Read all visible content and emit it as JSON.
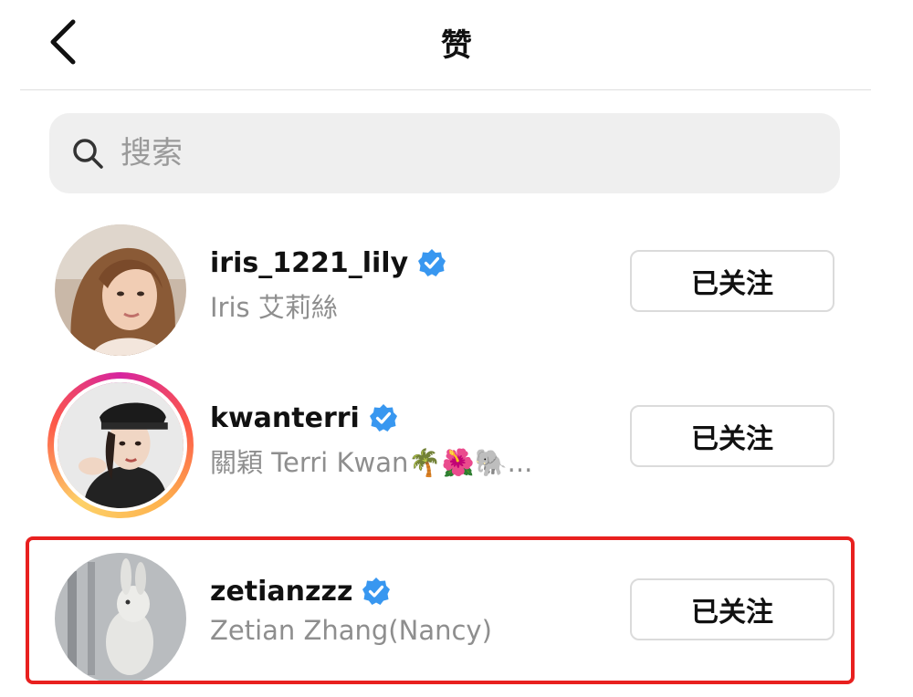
{
  "header": {
    "title": "赞"
  },
  "search": {
    "placeholder": "搜索"
  },
  "users": [
    {
      "username": "iris_1221_lily",
      "full_name": "Iris 艾莉絲",
      "verified": true,
      "has_story_ring": false,
      "follow_label": "已关注"
    },
    {
      "username": "kwanterri",
      "full_name": "關穎 Terri Kwan🌴🌺🐘...",
      "verified": true,
      "has_story_ring": true,
      "follow_label": "已关注"
    },
    {
      "username": "zetianzzz",
      "full_name": "Zetian Zhang(Nancy)",
      "verified": true,
      "has_story_ring": false,
      "follow_label": "已关注",
      "highlighted": true
    }
  ],
  "colors": {
    "verified_badge": "#3897f0",
    "highlight_border": "#e8201f",
    "secondary_text": "#8e8e8e"
  }
}
